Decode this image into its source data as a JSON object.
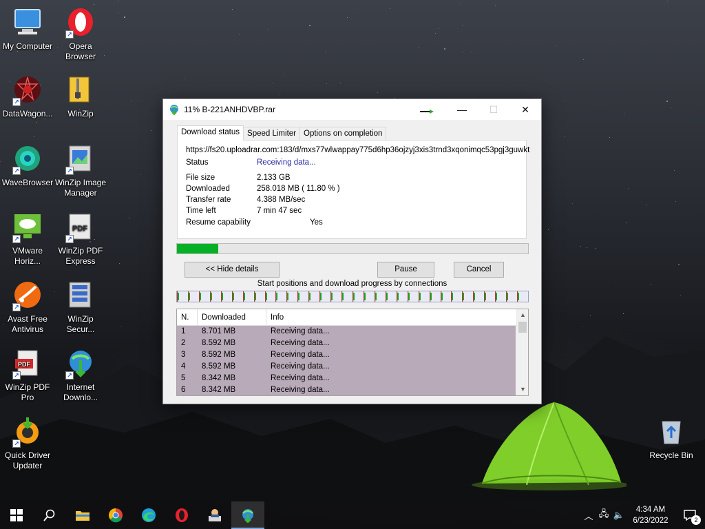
{
  "desktop": {
    "icons": [
      {
        "label": "My Computer",
        "icon": "computer-icon"
      },
      {
        "label": "Opera Browser",
        "icon": "opera-icon"
      },
      {
        "label": "DataWagon...",
        "icon": "datawagon-icon"
      },
      {
        "label": "WinZip",
        "icon": "winzip-icon"
      },
      {
        "label": "WaveBrowser",
        "icon": "wavebrowser-icon"
      },
      {
        "label": "WinZip Image Manager",
        "icon": "winzip-image-icon"
      },
      {
        "label": "VMware Horiz...",
        "icon": "vmware-icon"
      },
      {
        "label": "WinZip PDF Express",
        "icon": "winzip-pdf-express-icon"
      },
      {
        "label": "Avast Free Antivirus",
        "icon": "avast-icon"
      },
      {
        "label": "WinZip Secur...",
        "icon": "winzip-secure-icon"
      },
      {
        "label": "WinZip PDF Pro",
        "icon": "winzip-pdf-pro-icon"
      },
      {
        "label": "Internet Downlo...",
        "icon": "idm-icon"
      },
      {
        "label": "Quick Driver Updater",
        "icon": "quick-driver-icon"
      },
      {
        "label": "Recycle Bin",
        "icon": "recycle-bin-icon"
      }
    ]
  },
  "window": {
    "title": "11% B-221ANHDVBP.rar",
    "minimize": "—",
    "maximize": "☐",
    "close": "✕",
    "tabs": [
      "Download status",
      "Speed Limiter",
      "Options on completion"
    ],
    "active_tab": "Download status",
    "url": "https://fs20.uploadrar.com:183/d/mxs77wlwappay775d6hp36ojzyj3xis3trnd3xqonimqc53pgj3guwkt",
    "status_label": "Status",
    "status_value": "Receiving data...",
    "file_size_label": "File size",
    "file_size_value": "2.133  GB",
    "downloaded_label": "Downloaded",
    "downloaded_value": "258.018  MB  ( 11.80 % )",
    "transfer_rate_label": "Transfer rate",
    "transfer_rate_value": "4.388  MB/sec",
    "time_left_label": "Time left",
    "time_left_value": "7 min 47 sec",
    "resume_label": "Resume capability",
    "resume_value": "Yes",
    "progress_fraction": 0.118,
    "hide_details_label": "<< Hide details",
    "pause_label": "Pause",
    "cancel_label": "Cancel",
    "connections_caption": "Start positions and download progress by connections",
    "connection_count": 32,
    "columns": [
      "N.",
      "Downloaded",
      "Info"
    ],
    "rows": [
      {
        "n": "1",
        "downloaded": "8.701  MB",
        "info": "Receiving data..."
      },
      {
        "n": "2",
        "downloaded": "8.592  MB",
        "info": "Receiving data..."
      },
      {
        "n": "3",
        "downloaded": "8.592  MB",
        "info": "Receiving data..."
      },
      {
        "n": "4",
        "downloaded": "8.592  MB",
        "info": "Receiving data..."
      },
      {
        "n": "5",
        "downloaded": "8.342  MB",
        "info": "Receiving data..."
      },
      {
        "n": "6",
        "downloaded": "8.342  MB",
        "info": "Receiving data..."
      }
    ]
  },
  "taskbar": {
    "items": [
      "start-icon",
      "search-icon",
      "file-explorer-icon",
      "chrome-icon",
      "edge-icon",
      "opera-icon",
      "installer-icon",
      "idm-icon"
    ],
    "active_item": "idm-icon",
    "time": "4:34 AM",
    "date": "6/23/2022",
    "notification_count": "2"
  },
  "colors": {
    "progress_fill": "#06b025",
    "status_text": "#2b2ba8",
    "connections_row_bg": "#b8aab8"
  }
}
